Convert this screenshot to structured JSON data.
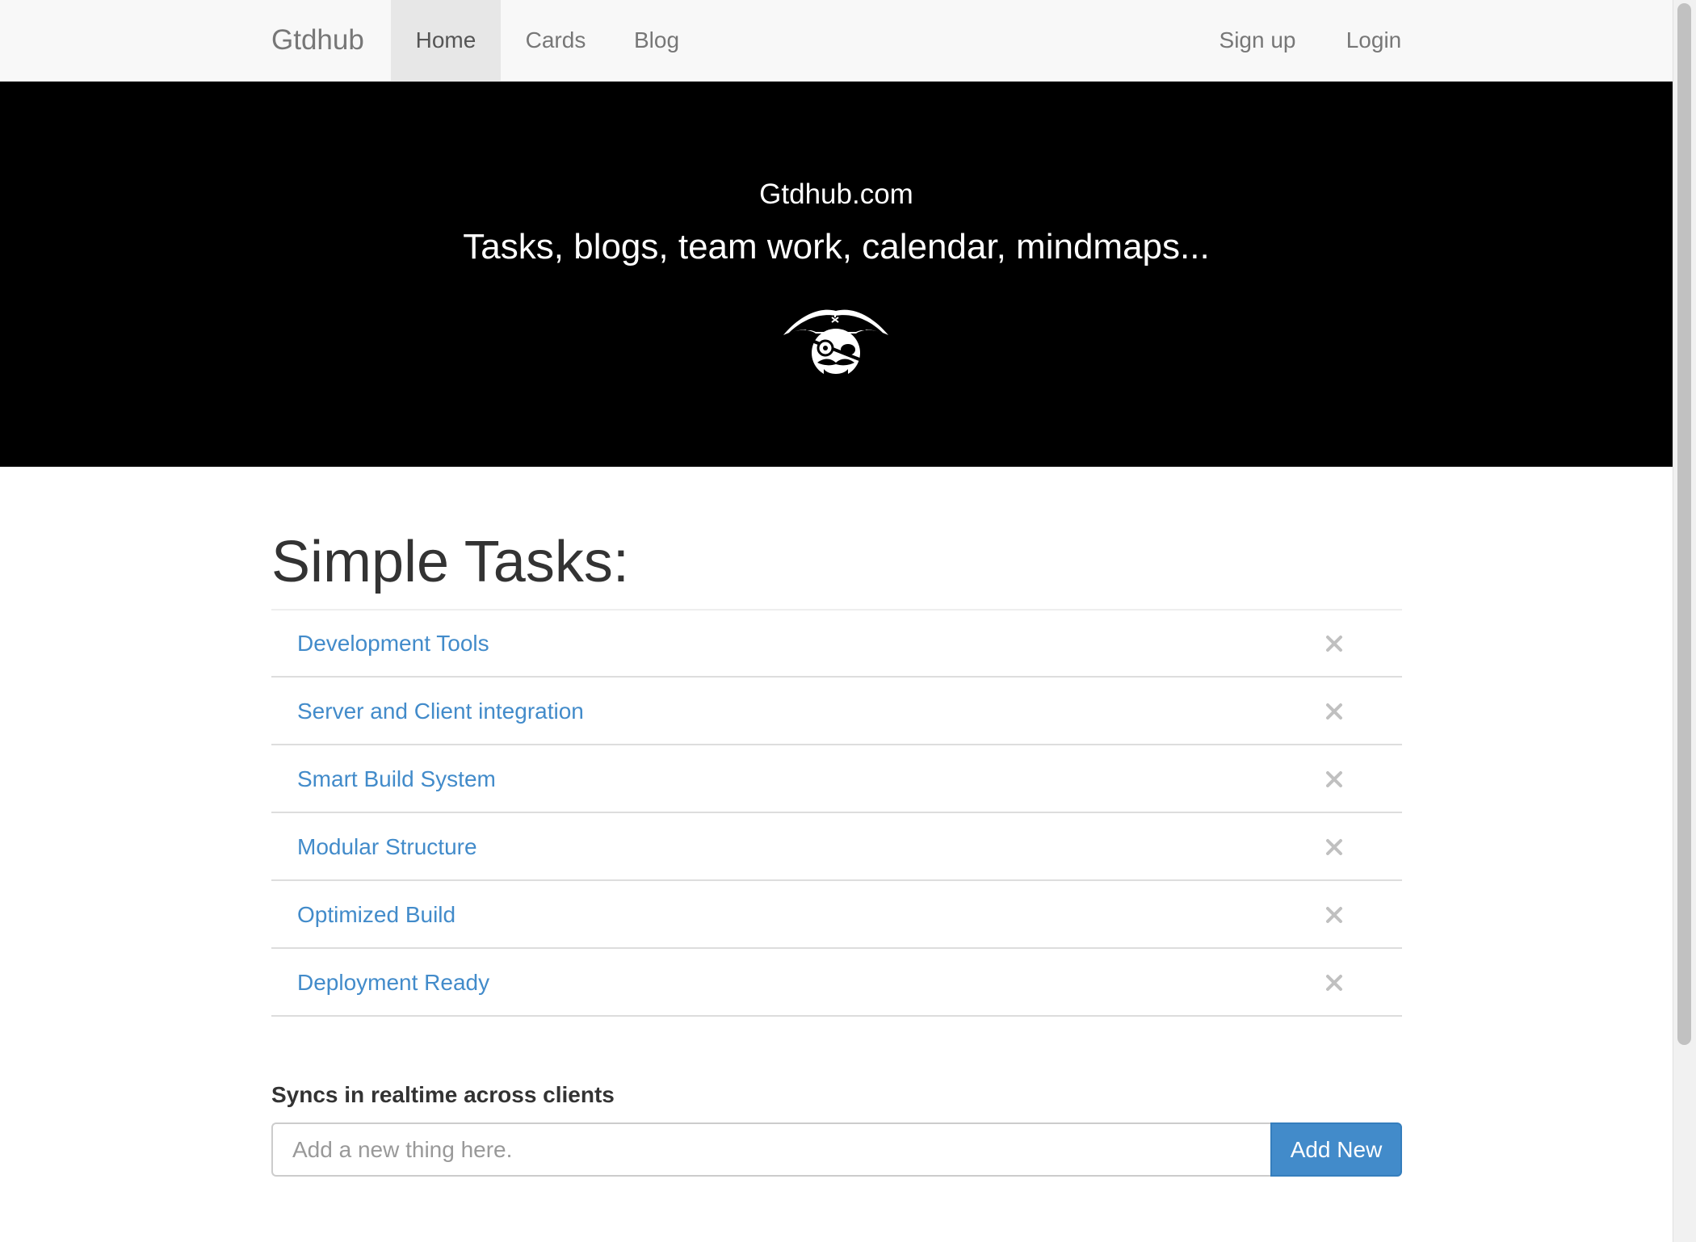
{
  "navbar": {
    "brand": "Gtdhub",
    "items": [
      {
        "label": "Home",
        "active": true
      },
      {
        "label": "Cards",
        "active": false
      },
      {
        "label": "Blog",
        "active": false
      }
    ],
    "right_items": [
      {
        "label": "Sign up"
      },
      {
        "label": "Login"
      }
    ]
  },
  "hero": {
    "title": "Gtdhub.com",
    "subtitle": "Tasks, blogs, team work, calendar, mindmaps...",
    "logo_icon": "pirate-icon"
  },
  "main": {
    "title": "Simple Tasks:",
    "tasks": [
      {
        "label": "Development Tools"
      },
      {
        "label": "Server and Client integration"
      },
      {
        "label": "Smart Build System"
      },
      {
        "label": "Modular Structure"
      },
      {
        "label": "Optimized Build"
      },
      {
        "label": "Deployment Ready"
      }
    ],
    "remove_icon": "close-icon",
    "sync_label": "Syncs in realtime across clients",
    "input": {
      "placeholder": "Add a new thing here.",
      "value": ""
    },
    "add_button": "Add New"
  },
  "colors": {
    "link": "#428bca",
    "primary_button": "#428bca",
    "navbar_bg": "#f8f8f8",
    "hero_bg": "#000000"
  }
}
